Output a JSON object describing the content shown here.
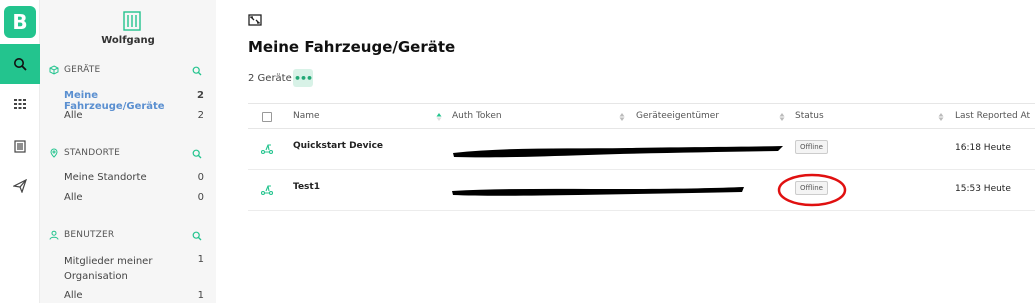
{
  "app": {
    "logo_letter": "B"
  },
  "rail": {
    "items": [
      {
        "name": "search",
        "active": true
      },
      {
        "name": "devices-grid",
        "active": false
      },
      {
        "name": "buildings",
        "active": false
      },
      {
        "name": "send",
        "active": false
      }
    ]
  },
  "sidebar": {
    "org_name": "Wolfgang",
    "sections": [
      {
        "title": "GERÄTE",
        "items": [
          {
            "label": "Meine Fahrzeuge/Geräte",
            "count": "2"
          },
          {
            "label": "Alle",
            "count": "2"
          }
        ]
      },
      {
        "title": "STANDORTE",
        "items": [
          {
            "label": "Meine Standorte",
            "count": "0"
          },
          {
            "label": "Alle",
            "count": "0"
          }
        ]
      },
      {
        "title": "BENUTZER",
        "items": [
          {
            "label": "Mitglieder meiner",
            "label2": "Organisation",
            "count": "1"
          },
          {
            "label": "Alle",
            "count": "1"
          }
        ]
      }
    ]
  },
  "main": {
    "title": "Meine Fahrzeuge/Geräte",
    "count_label": "2 Geräte",
    "more_label": "•••",
    "columns": [
      "Name",
      "Auth Token",
      "Geräteeigentümer",
      "Status",
      "Last Reported At"
    ],
    "rows": [
      {
        "name": "Quickstart Device",
        "status": "Offline",
        "last_reported": "16:18 Heute"
      },
      {
        "name": "Test1",
        "status": "Offline",
        "last_reported": "15:53 Heute"
      }
    ]
  },
  "colors": {
    "accent": "#23c48e",
    "active_link": "#5a8fd0",
    "annotation": "#e01010"
  }
}
